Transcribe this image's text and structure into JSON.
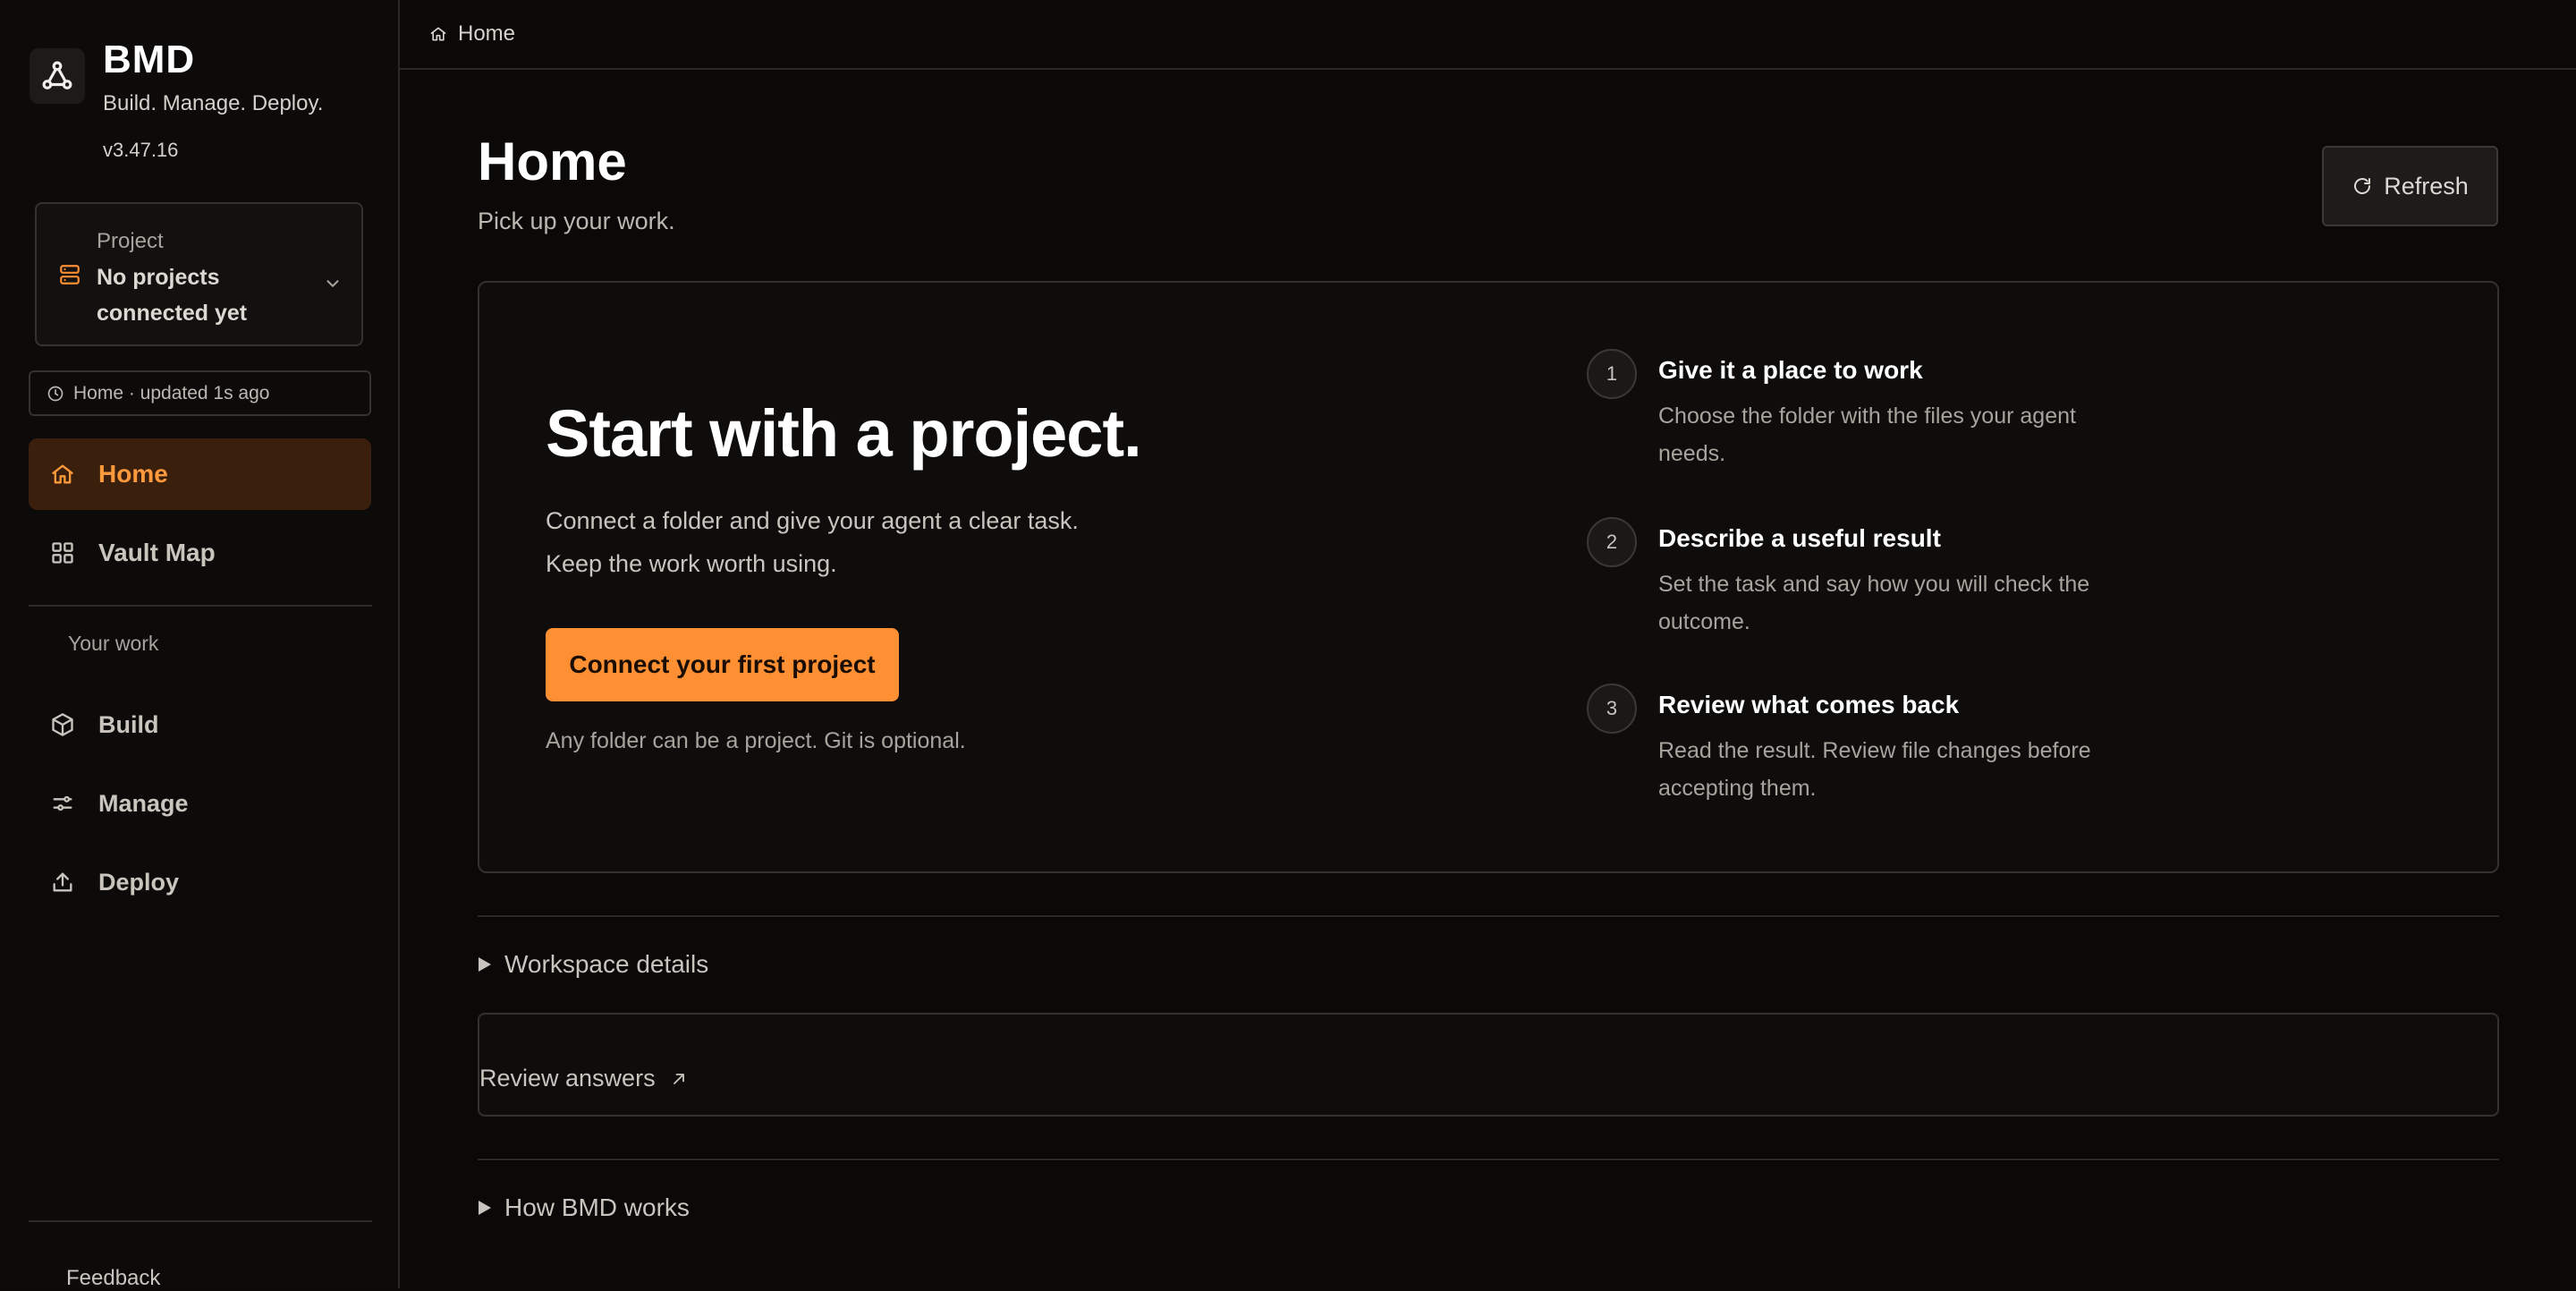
{
  "brand": {
    "name": "BMD",
    "tagline": "Build. Manage. Deploy.",
    "version": "v3.47.16",
    "icon": "network-nodes-icon"
  },
  "project": {
    "label": "Project",
    "value": "No projects connected yet",
    "icon": "server-stack-icon"
  },
  "status": {
    "text": "Home · updated 1s ago",
    "icon": "clock-icon"
  },
  "nav": {
    "primary": [
      {
        "label": "Home",
        "icon": "home-icon",
        "active": true
      },
      {
        "label": "Vault Map",
        "icon": "grid-icon",
        "active": false
      }
    ],
    "section_label": "Your work",
    "work": [
      {
        "label": "Build",
        "icon": "cube-icon"
      },
      {
        "label": "Manage",
        "icon": "sliders-icon"
      },
      {
        "label": "Deploy",
        "icon": "upload-icon"
      }
    ],
    "feedback": "Feedback"
  },
  "breadcrumb": {
    "label": "Home",
    "icon": "home-icon"
  },
  "page": {
    "title": "Home",
    "subtitle": "Pick up your work.",
    "refresh_label": "Refresh"
  },
  "hero": {
    "title": "Start with a project.",
    "body_line1": "Connect a folder and give your agent a clear task.",
    "body_line2": "Keep the work worth using.",
    "cta_label": "Connect your first project",
    "note": "Any folder can be a project. Git is optional."
  },
  "steps": [
    {
      "num": "1",
      "title": "Give it a place to work",
      "desc": "Choose the folder with the files your agent needs."
    },
    {
      "num": "2",
      "title": "Describe a useful result",
      "desc": "Set the task and say how you will check the outcome."
    },
    {
      "num": "3",
      "title": "Review what comes back",
      "desc": "Read the result. Review file changes before accepting them."
    }
  ],
  "sections": {
    "workspace_details": "Workspace details",
    "review_answers": "Review answers",
    "how_works": "How BMD works"
  },
  "colors": {
    "accent": "#ff8f33",
    "accent_text": "#ff9a3c",
    "active_bg": "#3b1f0d",
    "background": "#0a0908"
  }
}
